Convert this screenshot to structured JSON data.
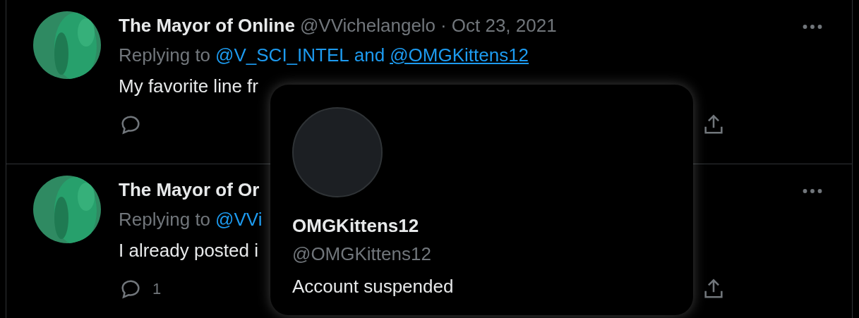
{
  "tweets": [
    {
      "name": "The Mayor of Online",
      "handle": "@VVichelangelo",
      "separator": "·",
      "date": "Oct 23, 2021",
      "replying_prefix": "Replying to",
      "mentions": [
        {
          "text": "@V_SCI_INTEL",
          "underlined": false
        },
        {
          "text": "@OMGKittens12",
          "underlined": true
        }
      ],
      "mention_joiner": "and",
      "text": "My favorite line fr"
    },
    {
      "name": "The Mayor of Or",
      "replying_prefix": "Replying to",
      "mentions": [
        {
          "text": "@VVi",
          "underlined": false
        }
      ],
      "text": "I already posted i",
      "reply_count": "1"
    }
  ],
  "hover_card": {
    "name": "OMGKittens12",
    "handle": "@OMGKittens12",
    "status": "Account suspended"
  }
}
